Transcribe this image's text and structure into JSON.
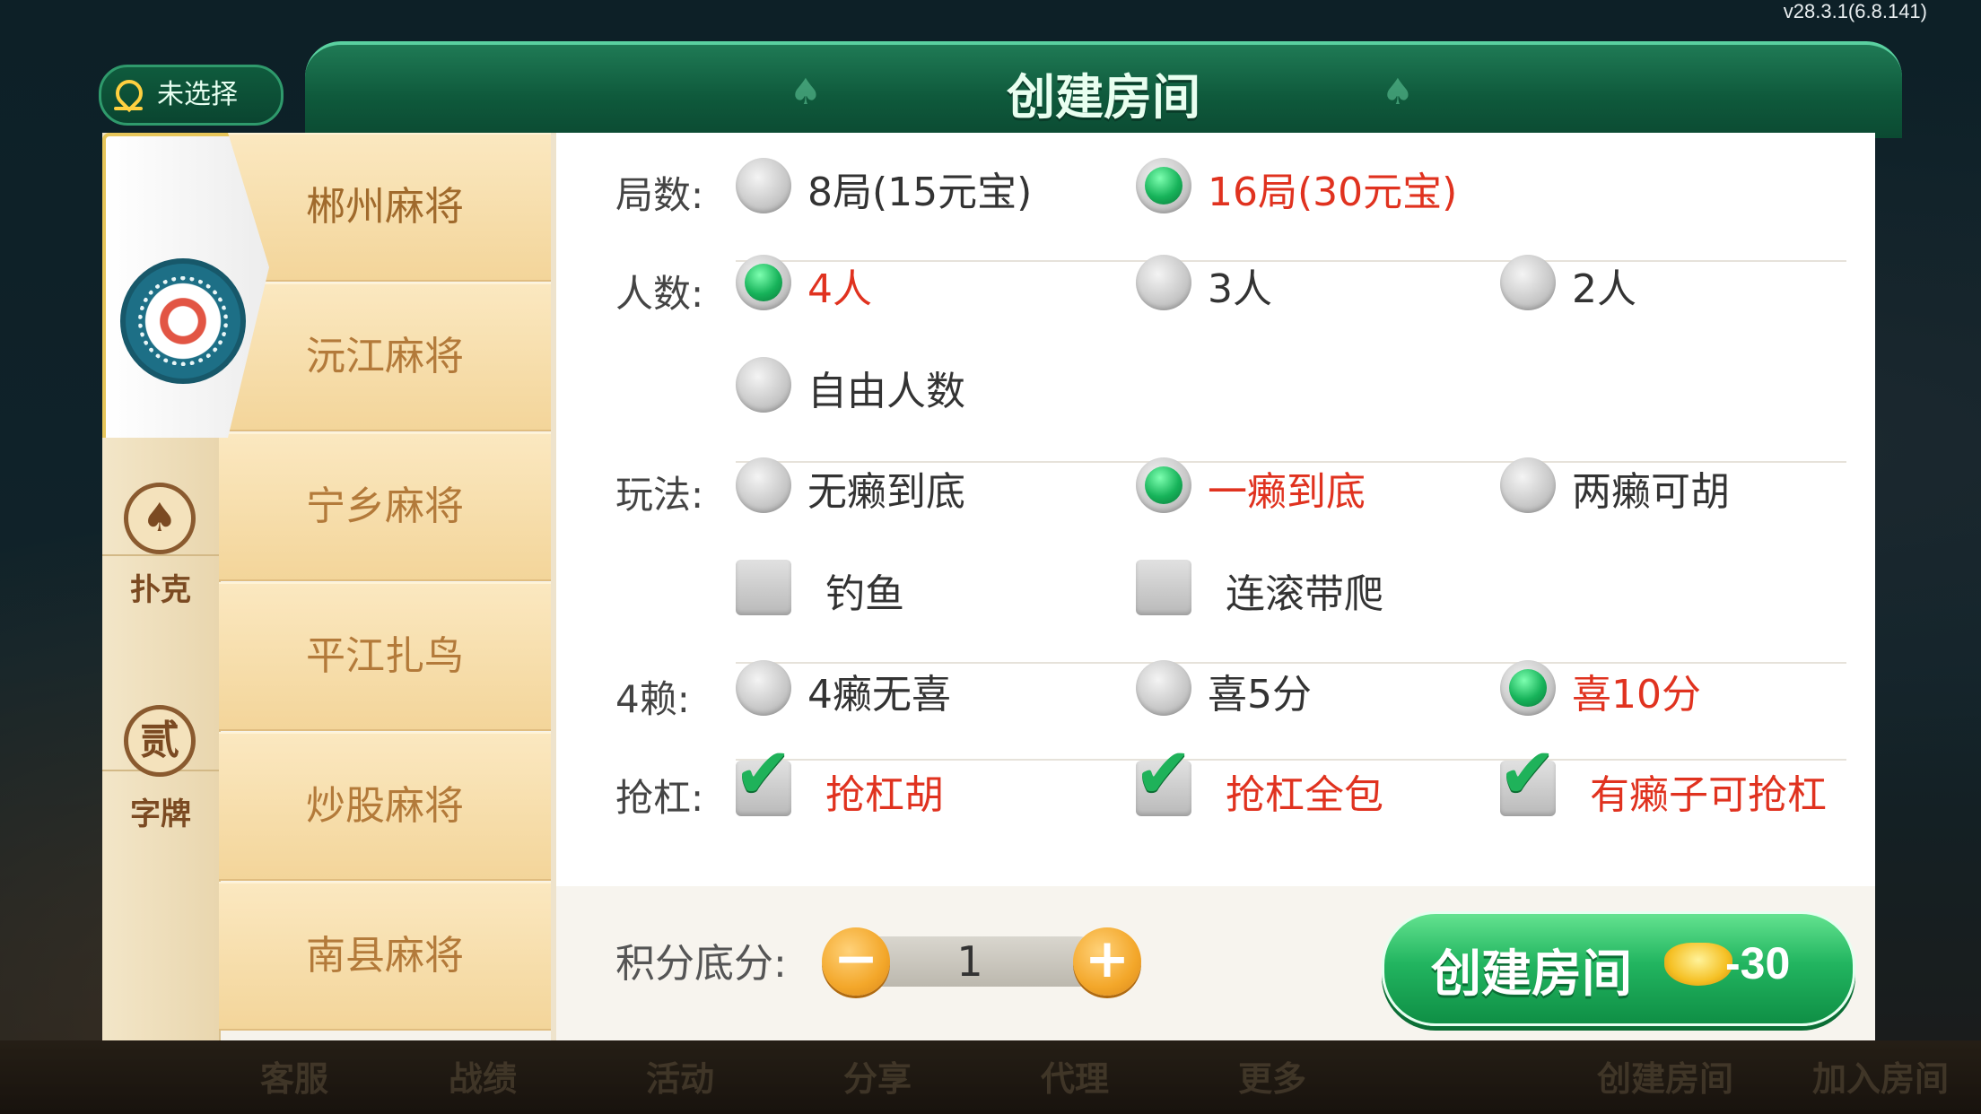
{
  "version": "v28.3.1(6.8.141)",
  "bottom_nav": [
    "客服",
    "战绩",
    "活动",
    "分享",
    "代理",
    "更多",
    "创建房间",
    "加入房间"
  ],
  "dialog": {
    "title": "创建房间",
    "location": "未选择",
    "categories": [
      {
        "id": "mahjong",
        "label": ""
      },
      {
        "id": "poker",
        "label": "扑克",
        "glyph": "♠"
      },
      {
        "id": "zipai",
        "label": "字牌",
        "glyph": "贰"
      }
    ],
    "games": [
      "郴州麻将",
      "沅江麻将",
      "宁乡麻将",
      "平江扎鸟",
      "炒股麻将",
      "南县麻将"
    ],
    "options": {
      "rounds": {
        "label": "局数:",
        "items": [
          {
            "text": "8局(15元宝)",
            "selected": false
          },
          {
            "text": "16局(30元宝)",
            "selected": true
          }
        ]
      },
      "players": {
        "label": "人数:",
        "items": [
          {
            "text": "4人",
            "selected": true
          },
          {
            "text": "3人",
            "selected": false
          },
          {
            "text": "2人",
            "selected": false
          },
          {
            "text": "自由人数",
            "selected": false
          }
        ]
      },
      "rules": {
        "label": "玩法:",
        "items": [
          {
            "text": "无癞到底",
            "selected": false
          },
          {
            "text": "一癞到底",
            "selected": true
          },
          {
            "text": "两癞可胡",
            "selected": false
          }
        ],
        "checks": [
          {
            "text": "钓鱼",
            "checked": false
          },
          {
            "text": "连滚带爬",
            "checked": false
          }
        ]
      },
      "four_lai": {
        "label": "4赖:",
        "items": [
          {
            "text": "4癞无喜",
            "selected": false
          },
          {
            "text": "喜5分",
            "selected": false
          },
          {
            "text": "喜10分",
            "selected": true
          }
        ]
      },
      "qianggang": {
        "label": "抢杠:",
        "checks": [
          {
            "text": "抢杠胡",
            "checked": true
          },
          {
            "text": "抢杠全包",
            "checked": true
          },
          {
            "text": "有癞子可抢杠",
            "checked": true
          }
        ]
      }
    },
    "score": {
      "label": "积分底分:",
      "value": "1",
      "minus": "−",
      "plus": "+"
    },
    "create_button": {
      "label": "创建房间",
      "cost": "-30"
    },
    "colors": {
      "accent_green": "#17b35a",
      "selected_red": "#e0321f",
      "header_green": "#0f5a3c"
    }
  }
}
